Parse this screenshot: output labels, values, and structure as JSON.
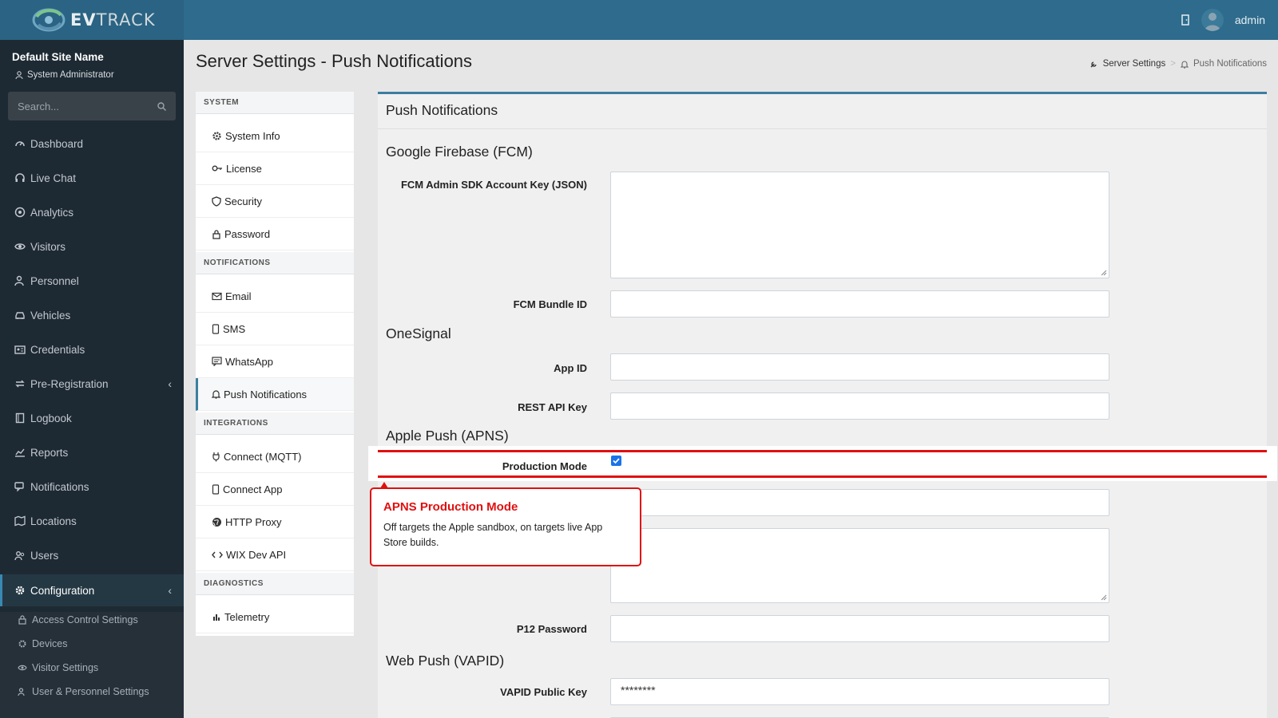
{
  "header": {
    "logo_ev": "EV",
    "logo_track": "TRACK",
    "user": "admin"
  },
  "sidebar": {
    "site_name": "Default Site Name",
    "role": "System Administrator",
    "search_placeholder": "Search...",
    "items": [
      {
        "label": "Dashboard",
        "icon": "dashboard-icon"
      },
      {
        "label": "Live Chat",
        "icon": "headset-icon"
      },
      {
        "label": "Analytics",
        "icon": "target-icon"
      },
      {
        "label": "Visitors",
        "icon": "eye-icon"
      },
      {
        "label": "Personnel",
        "icon": "user-tie-icon"
      },
      {
        "label": "Vehicles",
        "icon": "car-icon"
      },
      {
        "label": "Credentials",
        "icon": "id-card-icon"
      },
      {
        "label": "Pre-Registration",
        "icon": "swap-icon"
      },
      {
        "label": "Logbook",
        "icon": "book-icon"
      },
      {
        "label": "Reports",
        "icon": "chart-icon"
      },
      {
        "label": "Notifications",
        "icon": "chat-icon"
      },
      {
        "label": "Locations",
        "icon": "map-icon"
      },
      {
        "label": "Users",
        "icon": "users-icon"
      },
      {
        "label": "Configuration",
        "icon": "gear-icon"
      }
    ],
    "sub_items": [
      {
        "label": "Access Control Settings",
        "icon": "lock-icon"
      },
      {
        "label": "Devices",
        "icon": "gear-icon"
      },
      {
        "label": "Visitor Settings",
        "icon": "eye-icon"
      },
      {
        "label": "User & Personnel Settings",
        "icon": "users-icon"
      }
    ]
  },
  "page": {
    "title": "Server Settings - Push Notifications",
    "breadcrumb": [
      "Server Settings",
      "Push Notifications"
    ]
  },
  "settings_nav": {
    "groups": [
      {
        "title": "SYSTEM",
        "items": [
          "System Info",
          "License",
          "Security",
          "Password"
        ]
      },
      {
        "title": "NOTIFICATIONS",
        "items": [
          "Email",
          "SMS",
          "WhatsApp",
          "Push Notifications"
        ]
      },
      {
        "title": "INTEGRATIONS",
        "items": [
          "Connect (MQTT)",
          "Connect App",
          "HTTP Proxy",
          "WIX Dev API"
        ]
      },
      {
        "title": "DIAGNOSTICS",
        "items": [
          "Telemetry"
        ]
      }
    ],
    "active": "Push Notifications"
  },
  "form": {
    "card_title": "Push Notifications",
    "sections": {
      "fcm": "Google Firebase (FCM)",
      "onesignal": "OneSignal",
      "apns": "Apple Push (APNS)",
      "vapid": "Web Push (VAPID)"
    },
    "labels": {
      "fcm_key": "FCM Admin SDK Account Key (JSON)",
      "fcm_bundle": "FCM Bundle ID",
      "app_id": "App ID",
      "rest_key": "REST API Key",
      "production_mode": "Production Mode",
      "p12_password": "P12 Password",
      "vapid_public": "VAPID Public Key"
    },
    "values": {
      "production_mode_checked": true,
      "vapid_public": "********"
    }
  },
  "tooltip": {
    "title": "APNS Production Mode",
    "body": "Off targets the Apple sandbox, on targets live App Store builds."
  },
  "colors": {
    "header": "#2e6b8c",
    "sidebar": "#1e2a33",
    "accent": "#3b7ea1",
    "highlight": "#e01010"
  }
}
